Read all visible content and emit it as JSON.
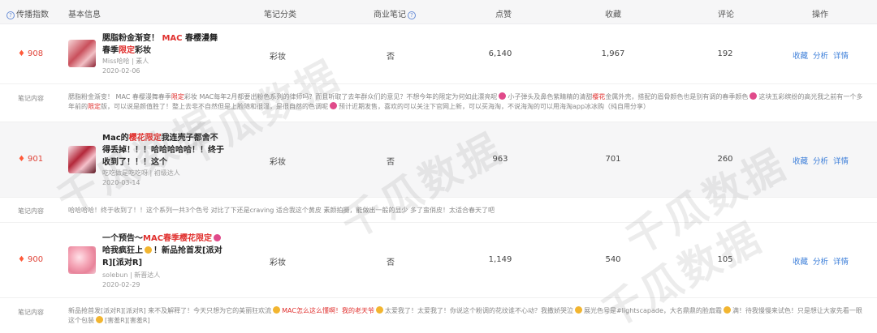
{
  "header": {
    "col_spread": "传播指数",
    "col_basic": "基本信息",
    "col_category": "笔记分类",
    "col_commercial": "商业笔记",
    "col_likes": "点赞",
    "col_favorites": "收藏",
    "col_comments": "评论",
    "col_actions": "操作"
  },
  "actions": {
    "favorite": "收藏",
    "analyze": "分析",
    "detail": "详情"
  },
  "content_label": "笔记内容",
  "watermark": "千瓜数据",
  "rows": [
    {
      "score": "908",
      "title_a": "腮脂粉金渐变！",
      "title_b": "MAC",
      "title_c": "春樱漫舞春季",
      "title_d": "限定",
      "title_e": "彩妆",
      "author": "Miss哈哈 | 素人",
      "date": "2020-02-06",
      "category": "彩妆",
      "commercial": "否",
      "likes": "6,140",
      "favorites": "1,967",
      "comments": "192",
      "content_a": "腮脂粉金渐变！ MAC 春樱漫舞春季",
      "content_b": "限定",
      "content_c": "彩妆 MAC每年2月都要出粉色系列的律师吗？而且听取了去年群众们的意见？不想今年的限定为何如此漂亮呢",
      "content_d": "小子弹头及鼻色紫睛精的清甜",
      "content_e": "樱花",
      "content_f": "金属外壳，搭配的眉骨颜色也是别有调的春季颜色",
      "content_g": "这块五彩缤纷的高光我之前有一个多年前的",
      "content_h": "限定",
      "content_i": "版，可以说是颜值胜了！整上去非不自然但是上脸随和很温，是很自然的色调呢",
      "content_j": "预计近期发售，喜欢的可以关注下官网上新，可以买海淘，不说海淘的可以用海淘app冰冰购（纯自用分享）"
    },
    {
      "score": "901",
      "title_a": "Mac的",
      "title_b": "樱花限定",
      "title_c": "我连壳子都舍不得丢掉！！！哈哈哈哈哈！！终于收到了！！！这个",
      "author": "吃吃做是吃吃呀 | 初级达人",
      "date": "2020-03-14",
      "category": "彩妆",
      "commercial": "否",
      "likes": "963",
      "favorites": "701",
      "comments": "260",
      "content": "哈哈哈哈！终于收到了！！这个系列一共3个色号 对比了下还是craving 适合我这个黄皮 素颜拍摄，能做出一般的显少 多了蛮俏皮！太适合春天了吧"
    },
    {
      "score": "900",
      "title_a": "一个预告～",
      "title_b": "MAC春季樱花限定",
      "title_c": "哈我疯狂上",
      "title_d": "！新品抢首发[派对R][派对R]",
      "author": "solebun | 新晋达人",
      "date": "2020-02-29",
      "category": "彩妆",
      "commercial": "否",
      "likes": "1,149",
      "favorites": "540",
      "comments": "105",
      "content_a": "新品抢首发[派对R][派对R] 来不及解释了！今天只想为它的美丽狂欢流",
      "content_b": "MAC怎么这么懂啊！我的老天爷",
      "content_c": "太爱我了！太爱我了！你说这个粉调的花纹谁不心动？我撒娇哭泣",
      "content_d": "展光色号是#lightscapade，大名鼎鼎的脸扇霜",
      "content_e": "满！待我慢慢来试色！只是想让大家先看一眼这个包装",
      "content_f": "[害羞R][害羞R]"
    }
  ]
}
